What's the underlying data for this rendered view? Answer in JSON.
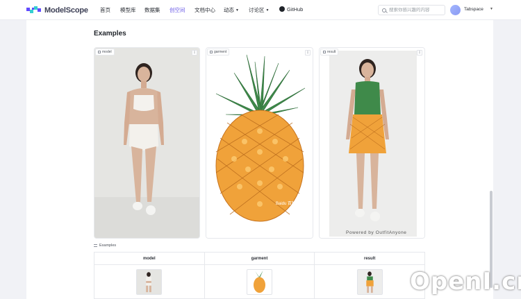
{
  "brand": {
    "name": "ModelScope",
    "accent": "#6c5ce7"
  },
  "nav": {
    "items": [
      {
        "label": "首页"
      },
      {
        "label": "模型库"
      },
      {
        "label": "数据集"
      },
      {
        "label": "创空间",
        "active": true
      },
      {
        "label": "文档中心"
      },
      {
        "label": "动态"
      },
      {
        "label": "讨论区"
      },
      {
        "label": "GitHub"
      }
    ]
  },
  "search": {
    "placeholder": "搜索你感兴趣的内容"
  },
  "user": {
    "name": "Tabspace"
  },
  "section": {
    "title": "Examples"
  },
  "panels": {
    "model": {
      "label": "model"
    },
    "garment": {
      "label": "garment",
      "overlay_text": "Baidu 百科"
    },
    "result": {
      "label": "result",
      "caption": "Powered by OutfitAnyone"
    }
  },
  "examples_table": {
    "title": "Examples",
    "columns": [
      "model",
      "garment",
      "result"
    ]
  },
  "watermark": {
    "text": "OpenI.cn"
  },
  "colors": {
    "pineapple_body": "#f0a23a",
    "pineapple_leaf": "#3f8a4a"
  }
}
